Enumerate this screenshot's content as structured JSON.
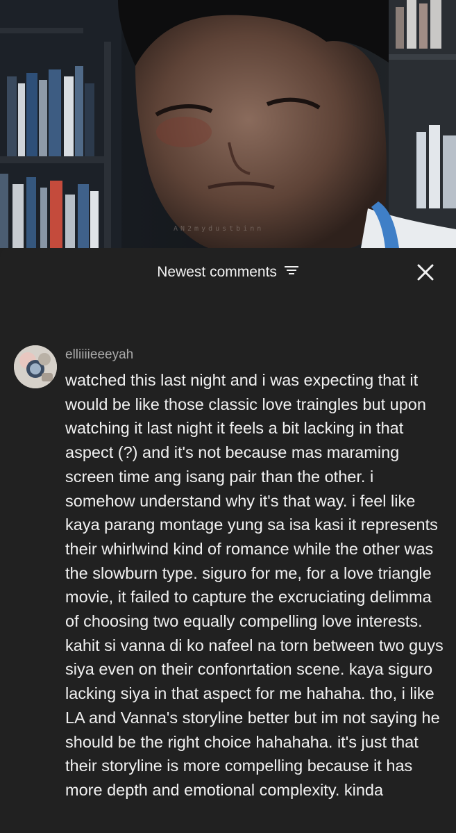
{
  "video": {
    "watermark": "AN2mydustbinn"
  },
  "comments_panel": {
    "title": "Newest comments",
    "sort_icon": "sort-lines-icon",
    "close_icon": "close-icon"
  },
  "comment": {
    "author": "elliiiieeeyah",
    "avatar_icon": "avatar",
    "text": "watched this last night and i was expecting that it would be like those classic love traingles but upon watching it last night it feels a bit lacking in that aspect (?) and it's not because mas maraming screen time ang isang pair than the other. i somehow understand why it's that way. i feel like kaya parang montage yung sa isa kasi it represents their whirlwind kind of romance while the other was the slowburn type. siguro for me, for a love triangle movie, it failed to capture the excruciating delimma of choosing two equally compelling love interests. kahit si vanna di ko nafeel na torn between two guys siya even on their confonrtation scene. kaya siguro lacking siya in that aspect for me hahaha. tho, i like LA and Vanna's storyline better but im not saying he should be the right choice hahahaha. it's just that their storyline is more compelling because it has more depth and emotional complexity. kinda"
  },
  "colors": {
    "sheet_background": "#212121",
    "primary_text": "#f1f1f1",
    "secondary_text": "#aaaaaa"
  }
}
